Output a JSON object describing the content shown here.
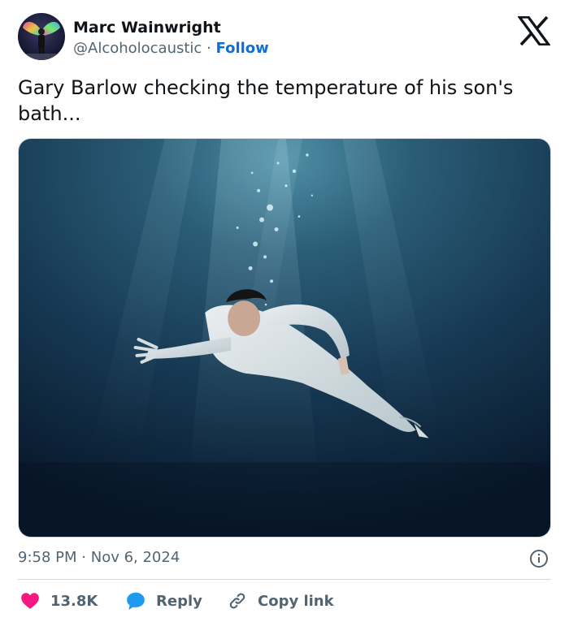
{
  "author": {
    "name": "Marc Wainwright",
    "handle": "@Alcoholocaustic",
    "separator": "·",
    "follow_label": "Follow"
  },
  "tweet": {
    "text": "Gary Barlow checking the temperature of his son's bath...",
    "time": "9:58 PM",
    "separator": "·",
    "date": "Nov 6, 2024"
  },
  "actions": {
    "likes_count": "13.8K",
    "reply_label": "Reply",
    "copy_link_label": "Copy link"
  },
  "icons": {
    "brand": "x-logo-icon",
    "info": "info-icon",
    "like": "heart-icon",
    "reply": "speech-bubble-icon",
    "copy": "link-icon"
  },
  "colors": {
    "follow_blue": "#0f6fd6",
    "like_red": "#f91880",
    "reply_blue": "#1d9bf0",
    "muted": "#536471"
  }
}
